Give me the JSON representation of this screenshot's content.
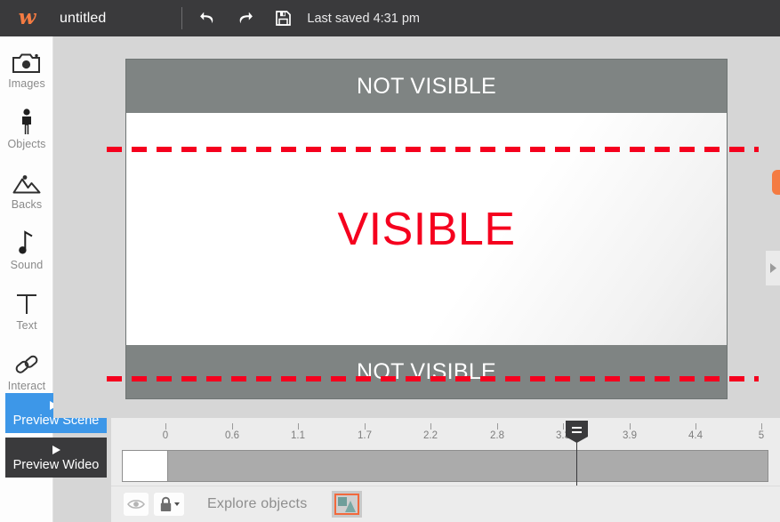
{
  "topbar": {
    "logo": "w-logo-icon",
    "doc_title": "untitled",
    "undo": "undo-icon",
    "redo": "redo-icon",
    "save": "save-icon",
    "saved_status": "Last saved 4:31 pm"
  },
  "sidebar": {
    "items": [
      {
        "label": "Images",
        "icon": "camera-icon"
      },
      {
        "label": "Objects",
        "icon": "person-icon"
      },
      {
        "label": "Backs",
        "icon": "mountain-icon"
      },
      {
        "label": "Sound",
        "icon": "music-note-icon"
      },
      {
        "label": "Text",
        "icon": "text-t-icon"
      },
      {
        "label": "Interact",
        "icon": "chain-link-icon"
      }
    ],
    "more_indicator": "scroll-down-icon",
    "preview_scene": {
      "label": "Preview Scene",
      "icon": "play-to-end-icon",
      "color": "#3d97e8"
    },
    "preview_video": {
      "label": "Preview Wideo",
      "icon": "play-icon",
      "color": "#3a3a3c"
    }
  },
  "stage": {
    "band_top_text": "NOT VISIBLE",
    "band_bottom_text": "NOT VISIBLE",
    "visible_text": "VISIBLE",
    "guide_color": "#f5001e",
    "band_color": "#7f8483",
    "right_tab": "orange-panel-tab",
    "right_expander": "expand-panel-arrow-icon"
  },
  "timeline": {
    "ticks": [
      "0",
      "0.6",
      "1.1",
      "1.7",
      "2.2",
      "2.8",
      "3.3",
      "3.9",
      "4.4",
      "5"
    ],
    "playhead": "playhead-handle",
    "track_thumbnail": "scene-thumbnail"
  },
  "bottombar": {
    "visibility": "eye-icon",
    "lock": "lock-icon",
    "lock_dropdown": "chevron-down-icon",
    "layer_label": "Explore objects",
    "shapes": "shapes-icon"
  }
}
